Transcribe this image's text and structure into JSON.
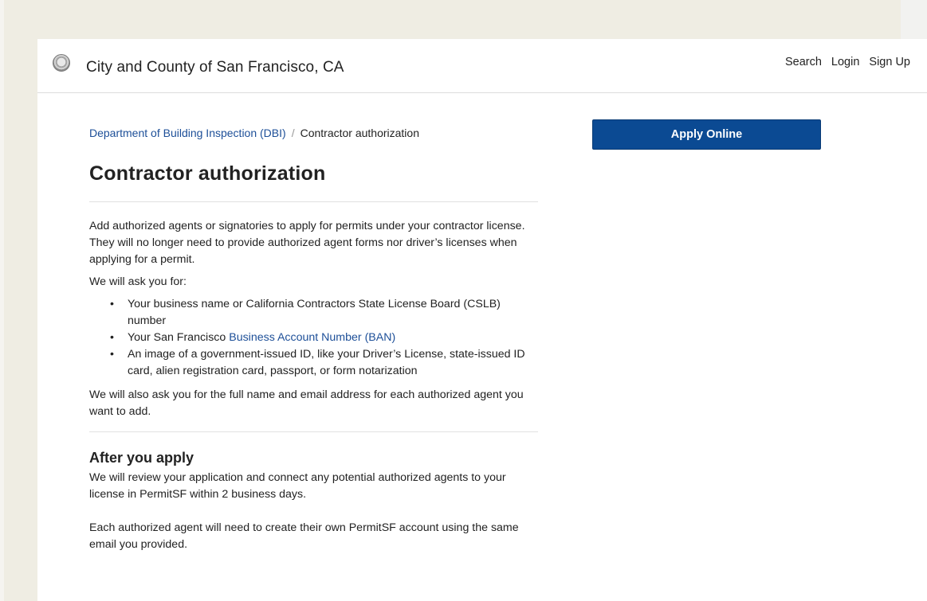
{
  "header": {
    "site_title": "City and County of San Francisco, CA",
    "nav": [
      "Search",
      "Login",
      "Sign Up"
    ]
  },
  "breadcrumb": {
    "parent": "Department of Building Inspection (DBI)",
    "separator": "/",
    "current": "Contractor authorization"
  },
  "page": {
    "title": "Contractor authorization",
    "intro": "Add authorized agents or signatories to apply for permits under your contractor license. They will no longer need to provide authorized agent forms nor driver’s licenses when applying for a permit.",
    "ask_heading": "We will ask you for:",
    "requirements": {
      "item1": "Your business name or California Contractors State License Board (CSLB) number",
      "item2_prefix": "Your San Francisco ",
      "item2_link": "Business Account Number (BAN)",
      "item3": "An image of a government-issued ID, like your Driver’s License, state-issued ID card, alien registration card, passport, or form notarization"
    },
    "also": "We will also ask you for the full name and email address for each authorized agent you want to add.",
    "after_heading": "After you apply",
    "after_p1": "We will review your application and connect any potential authorized agents to your license in PermitSF within 2 business days.",
    "after_p2": "Each authorized agent will need to create their own PermitSF account using the same email you provided."
  },
  "apply_button": "Apply Online",
  "colors": {
    "link": "#1d4f98",
    "button": "#0b4a93"
  }
}
